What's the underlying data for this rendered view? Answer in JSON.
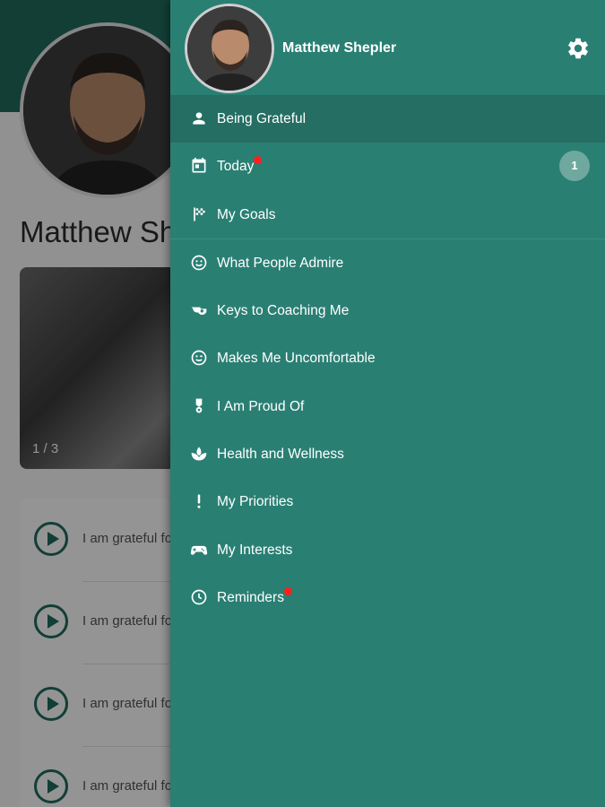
{
  "background": {
    "profile_name": "Matthew Shepler",
    "carousel_counter": "1 / 3",
    "rows": [
      {
        "text": "I am grateful for my family and friends"
      },
      {
        "text": "I am grateful for my health"
      },
      {
        "text": "I am grateful for my career"
      },
      {
        "text": "I am grateful for my team"
      }
    ]
  },
  "drawer": {
    "user_name": "Matthew Shepler",
    "settings_icon": "gear-icon",
    "menu": [
      {
        "label": "Being Grateful",
        "icon": "person-icon",
        "active": true
      },
      {
        "label": "Today",
        "icon": "calendar-icon",
        "dot": true,
        "badge": "1"
      },
      {
        "label": "My Goals",
        "icon": "checkered-flag-icon"
      },
      {
        "label": "What People Admire",
        "icon": "smiley-icon"
      },
      {
        "label": "Keys to Coaching Me",
        "icon": "whistle-icon"
      },
      {
        "label": "Makes Me Uncomfortable",
        "icon": "wink-face-icon"
      },
      {
        "label": "I Am Proud Of",
        "icon": "medal-icon"
      },
      {
        "label": "Health and Wellness",
        "icon": "spa-icon"
      },
      {
        "label": "My Priorities",
        "icon": "exclamation-icon"
      },
      {
        "label": "My Interests",
        "icon": "gamepad-icon"
      },
      {
        "label": "Reminders",
        "icon": "clock-icon",
        "dot": true
      }
    ]
  },
  "colors": {
    "drawer_bg": "#2a7f73",
    "active_bg": "#246e63",
    "notification_dot": "#ff1f1f",
    "badge_bg": "#6ea89f"
  }
}
